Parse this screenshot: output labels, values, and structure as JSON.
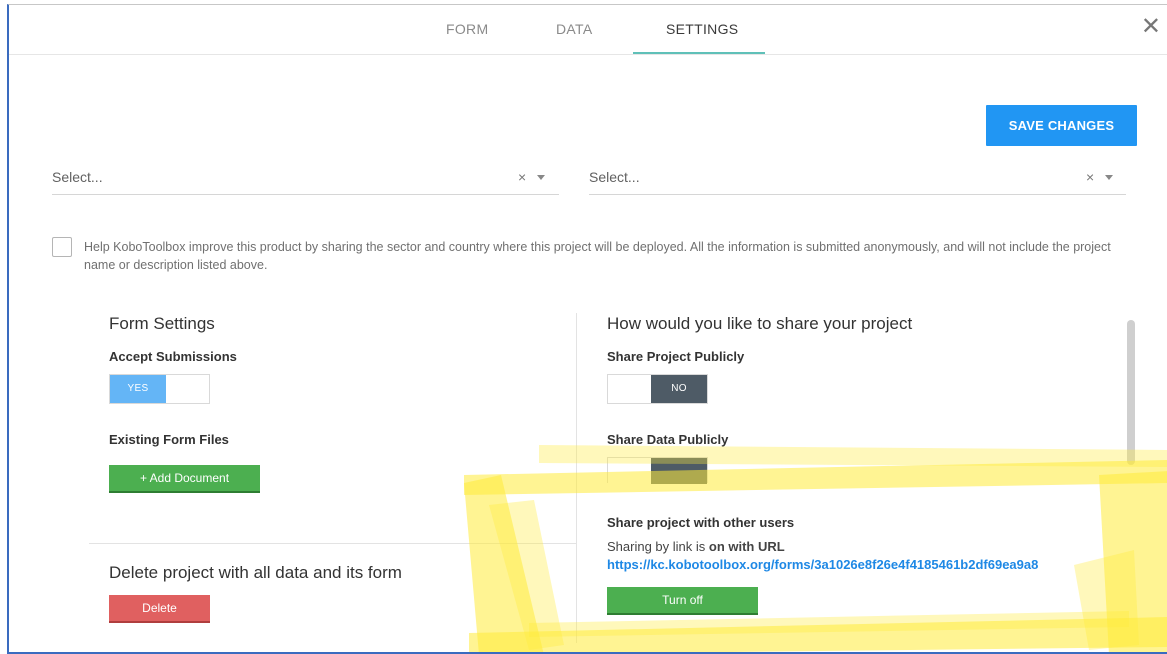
{
  "tabs": [
    {
      "label": "FORM",
      "active": false
    },
    {
      "label": "DATA",
      "active": false
    },
    {
      "label": "SETTINGS",
      "active": true
    }
  ],
  "toolbar": {
    "save_label": "SAVE CHANGES"
  },
  "selects": {
    "sector_placeholder": "Select...",
    "country_placeholder": "Select...",
    "clear_glyph": "×"
  },
  "help": {
    "text": "Help KoboToolbox improve this product by sharing the sector and country where this project will be deployed. All the information is submitted anonymously, and will not include the project name or description listed above.",
    "checked": false
  },
  "form_settings": {
    "title": "Form Settings",
    "accept_label": "Accept Submissions",
    "accept_value": "YES",
    "files_label": "Existing Form Files",
    "add_document_label": "+ Add Document",
    "delete_title": "Delete project with all data and its form",
    "delete_label": "Delete"
  },
  "sharing": {
    "title": "How would you like to share your project",
    "share_project_label": "Share Project Publicly",
    "share_project_value": "NO",
    "share_data_label": "Share Data Publicly",
    "share_users_label": "Share project with other users",
    "link_status_prefix": "Sharing by link is ",
    "link_status_bold": "on with URL",
    "url": "https://kc.kobotoolbox.org/forms/3a1026e8f26e4f4185461b2df69ea9a8",
    "turn_off_label": "Turn off"
  },
  "colors": {
    "accent_tab": "#5fc0b8",
    "save_button": "#2196f3",
    "toggle_yes": "#64b5f6",
    "toggle_no": "#4e5b66",
    "green_button": "#4caf50",
    "red_button": "#e06060",
    "link": "#1e88e5",
    "highlight": "#ffeb3b"
  }
}
